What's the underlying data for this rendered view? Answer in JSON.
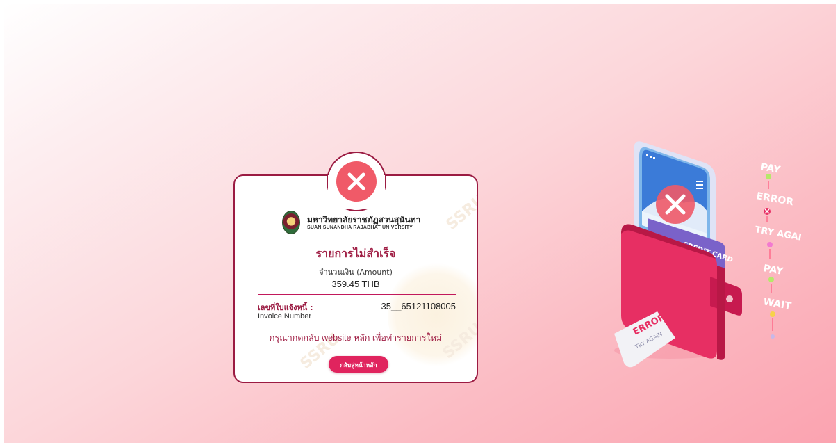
{
  "card": {
    "university_th": "มหาวิทยาลัยราชภัฏสวนสุนันทา",
    "university_en": "SUAN SUNANDHA RAJABHAT UNIVERSITY",
    "title": "รายการไม่สำเร็จ",
    "amount_label": "จำนวนเงิน (Amount)",
    "amount_value": "359.45 THB",
    "invoice_label_th": "เลขที่ใบแจ้งหนี้ :",
    "invoice_label_en": "Invoice Number",
    "invoice_value": "35__65121108005",
    "instruction": "กรุณากดกลับ website หลัก เพื่อทำรายการใหม่",
    "home_button": "กลับสู่หน้าหลัก",
    "watermark": "SSRU"
  },
  "illustration": {
    "flow_steps": [
      "PAY",
      "ERROR",
      "TRY AGAIN",
      "PAY",
      "WAIT"
    ],
    "card_text": "CREDIT CARD",
    "receipt_title": "ERROR",
    "receipt_sub": "TRY AGAIN"
  },
  "colors": {
    "accent": "#e0245e",
    "error": "#f05a68",
    "border": "#9b1b42"
  }
}
